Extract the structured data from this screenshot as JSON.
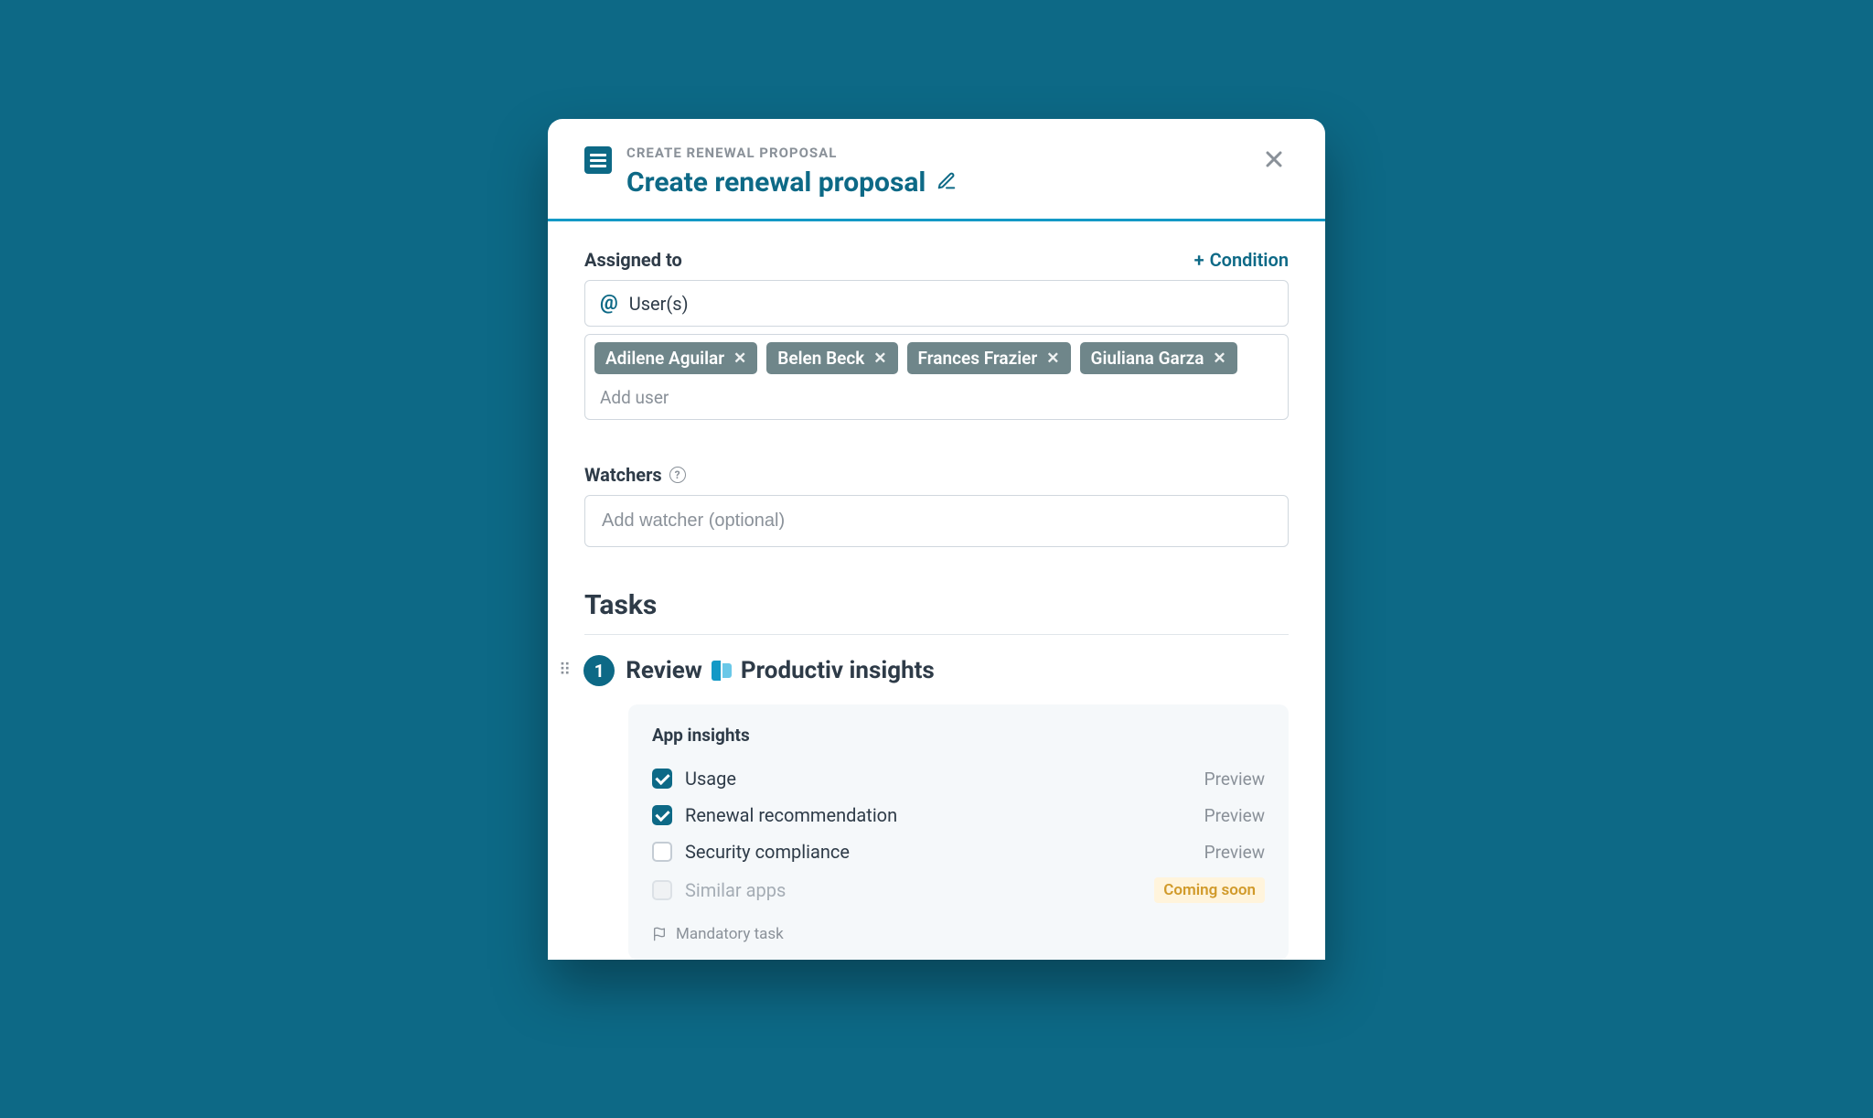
{
  "header": {
    "eyebrow": "CREATE RENEWAL PROPOSAL",
    "title": "Create renewal proposal"
  },
  "assigned": {
    "label": "Assigned to",
    "condition_label": "Condition",
    "select_text": "User(s)",
    "chips": [
      "Adilene Aguilar",
      "Belen Beck",
      "Frances Frazier",
      "Giuliana Garza"
    ],
    "add_placeholder": "Add user"
  },
  "watchers": {
    "label": "Watchers",
    "placeholder": "Add watcher (optional)"
  },
  "tasks": {
    "heading": "Tasks",
    "task1": {
      "number": "1",
      "title_prefix": "Review",
      "title_suffix": "Productiv insights",
      "insights_title": "App insights",
      "items": [
        {
          "label": "Usage",
          "checked": true,
          "action": "Preview"
        },
        {
          "label": "Renewal recommendation",
          "checked": true,
          "action": "Preview"
        },
        {
          "label": "Security compliance",
          "checked": false,
          "action": "Preview"
        },
        {
          "label": "Similar apps",
          "checked": false,
          "disabled": true,
          "badge": "Coming soon"
        }
      ],
      "mandatory_label": "Mandatory task"
    }
  }
}
